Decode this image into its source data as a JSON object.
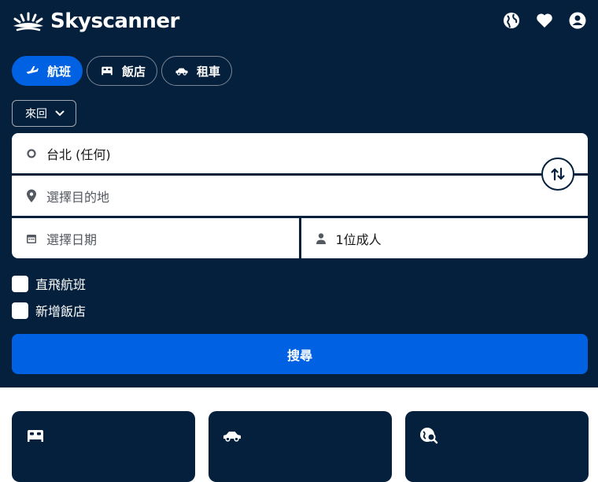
{
  "brand": {
    "name": "Skyscanner"
  },
  "header_icons": [
    "globe-icon",
    "heart-icon",
    "account-icon"
  ],
  "tabs": [
    {
      "label": "航班",
      "icon": "plane-icon",
      "active": true
    },
    {
      "label": "飯店",
      "icon": "bed-icon",
      "active": false
    },
    {
      "label": "租車",
      "icon": "car-icon",
      "active": false
    }
  ],
  "trip_type": {
    "selected": "來回"
  },
  "form": {
    "origin": {
      "value": "台北 (任何)"
    },
    "destination": {
      "placeholder": "選擇目的地"
    },
    "date": {
      "placeholder": "選擇日期"
    },
    "travellers": {
      "value": "1位成人"
    }
  },
  "options": [
    {
      "label": "直飛航班",
      "checked": false
    },
    {
      "label": "新增飯店",
      "checked": false
    }
  ],
  "search_button": {
    "label": "搜尋"
  },
  "cards": [
    {
      "icon": "bed-icon"
    },
    {
      "icon": "car-icon"
    },
    {
      "icon": "explore-icon"
    }
  ],
  "colors": {
    "background": "#05203c",
    "primary": "#0062e3",
    "surface": "#ffffff"
  }
}
